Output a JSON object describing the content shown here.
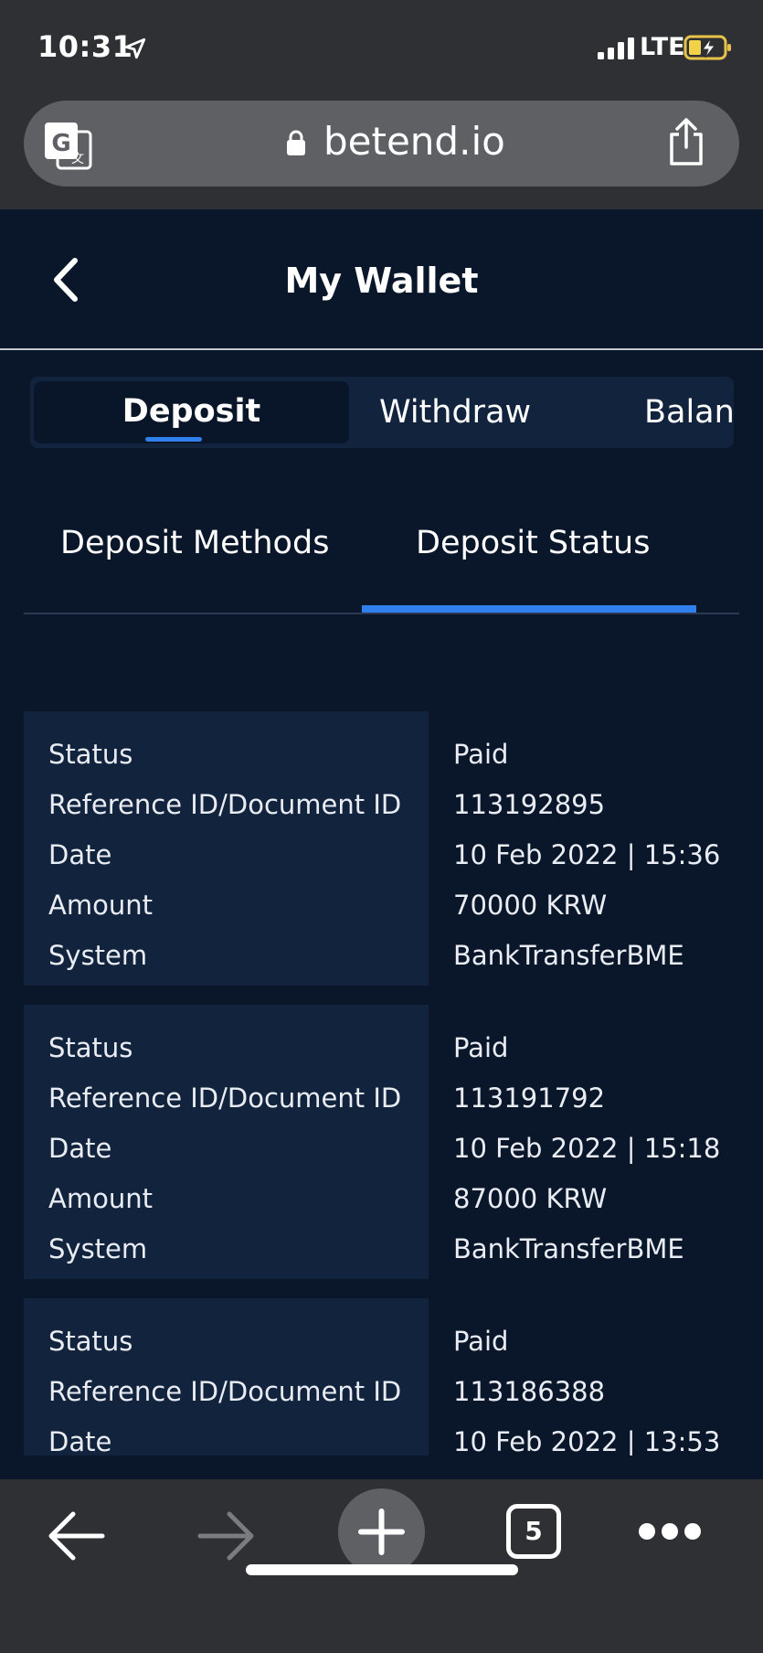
{
  "status_bar": {
    "time": "10:31",
    "network": "LTE",
    "icons": [
      "location-arrow-icon",
      "signal-bars-icon",
      "battery-charging-icon"
    ]
  },
  "browser": {
    "url": "betend.io",
    "icons": [
      "translate-icon",
      "lock-icon",
      "share-icon"
    ]
  },
  "header": {
    "title": "My Wallet",
    "back_icon": "chevron-left-icon"
  },
  "main_tabs": [
    {
      "label": "Deposit",
      "active": true
    },
    {
      "label": "Withdraw",
      "active": false
    },
    {
      "label": "Balan",
      "active": false
    }
  ],
  "sub_tabs": [
    {
      "label": "Deposit Methods",
      "active": false
    },
    {
      "label": "Deposit Status",
      "active": true
    }
  ],
  "labels": {
    "status": "Status",
    "reference": "Reference ID/Document ID",
    "date": "Date",
    "amount": "Amount",
    "system": "System"
  },
  "records": [
    {
      "status": "Paid",
      "reference": "113192895",
      "date": "10 Feb 2022 | 15:36",
      "amount": "70000 KRW",
      "system": "BankTransferBME"
    },
    {
      "status": "Paid",
      "reference": "113191792",
      "date": "10 Feb 2022 | 15:18",
      "amount": "87000 KRW",
      "system": "BankTransferBME"
    },
    {
      "status": "Paid",
      "reference": "113186388",
      "date": "10 Feb 2022 | 13:53",
      "amount": "",
      "system": ""
    }
  ],
  "toolbar": {
    "tab_count": "5",
    "icons": [
      "back-arrow-icon",
      "forward-arrow-icon",
      "plus-icon",
      "tabs-icon",
      "more-dots-icon"
    ]
  },
  "colors": {
    "background": "#0a172b",
    "panel": "#12233d",
    "accent": "#2f80ed",
    "chrome": "#2f3033"
  }
}
